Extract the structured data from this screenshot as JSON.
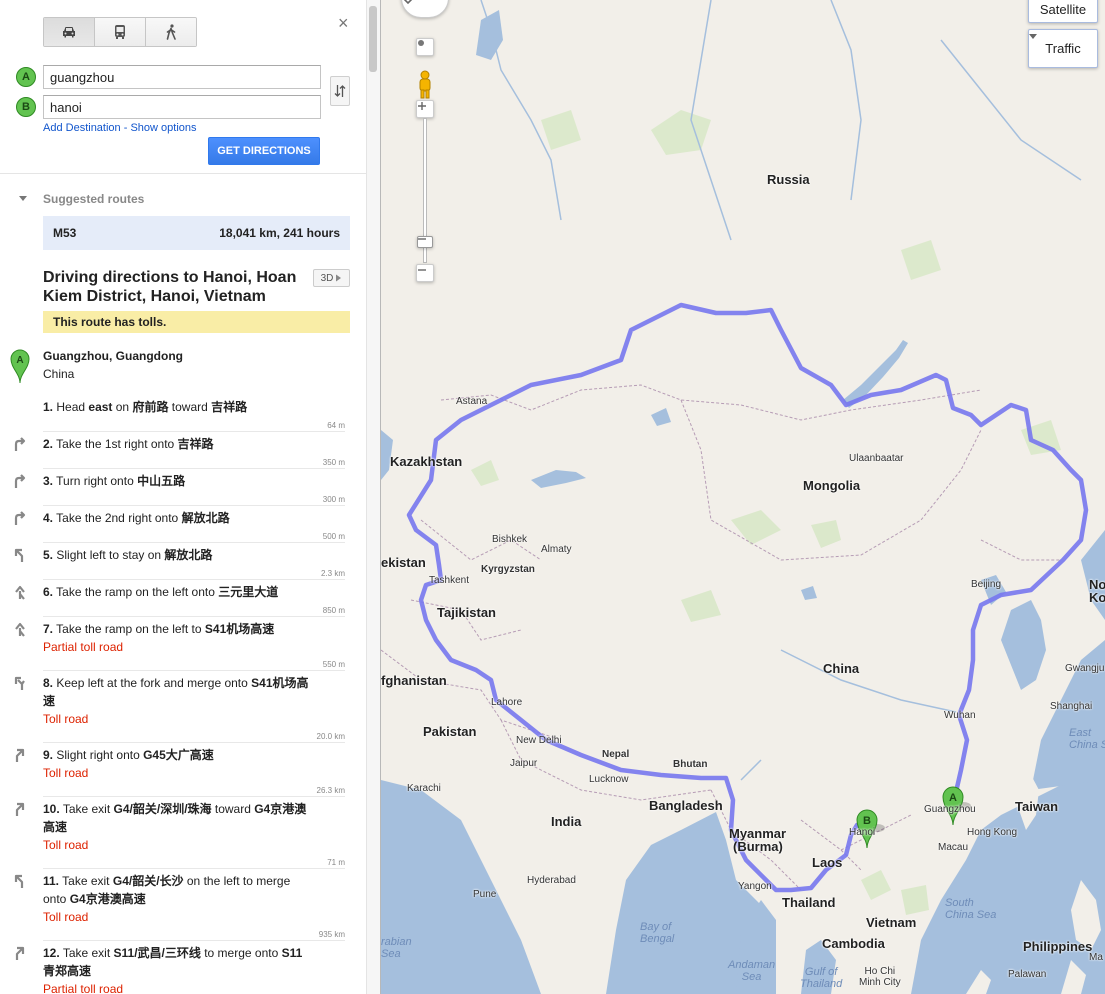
{
  "travel_modes": [
    {
      "name": "car-icon",
      "active": true
    },
    {
      "name": "bus-icon",
      "active": false
    },
    {
      "name": "walk-icon",
      "active": false
    }
  ],
  "close_label": "×",
  "origin": {
    "marker": "A",
    "value": "guangzhou"
  },
  "destination": {
    "marker": "B",
    "value": "hanoi"
  },
  "add_destination": "Add Destination",
  "options_sep": " - ",
  "show_options": "Show options",
  "get_directions": "GET DIRECTIONS",
  "suggested_routes_title": "Suggested routes",
  "route": {
    "name": "M53",
    "summary": "18,041 km, 241 hours"
  },
  "directions_title": "Driving directions to Hanoi, Hoan Kiem District, Hanoi, Vietnam",
  "btn_3d": "3D",
  "toll_notice": "This route has tolls.",
  "start": {
    "marker": "A",
    "name": "Guangzhou, Guangdong",
    "country": "China"
  },
  "steps": [
    {
      "num": "1.",
      "pre": "Head ",
      "b1": "east",
      "mid": " on ",
      "b2": "府前路",
      "post": " toward ",
      "b3": "吉祥路",
      "toll": "",
      "dist": "64 m",
      "icon": "straight-icon"
    },
    {
      "num": "2.",
      "pre": "Take the 1st right onto ",
      "b1": "吉祥路",
      "mid": "",
      "b2": "",
      "post": "",
      "b3": "",
      "toll": "",
      "dist": "350 m",
      "icon": "turn-right-icon"
    },
    {
      "num": "3.",
      "pre": "Turn right onto ",
      "b1": "中山五路",
      "mid": "",
      "b2": "",
      "post": "",
      "b3": "",
      "toll": "",
      "dist": "300 m",
      "icon": "turn-right-icon"
    },
    {
      "num": "4.",
      "pre": "Take the 2nd right onto ",
      "b1": "解放北路",
      "mid": "",
      "b2": "",
      "post": "",
      "b3": "",
      "toll": "",
      "dist": "500 m",
      "icon": "turn-right-icon"
    },
    {
      "num": "5.",
      "pre": "Slight left to stay on ",
      "b1": "解放北路",
      "mid": "",
      "b2": "",
      "post": "",
      "b3": "",
      "toll": "",
      "dist": "2.3 km",
      "icon": "slight-left-icon"
    },
    {
      "num": "6.",
      "pre": "Take the ramp on the left onto ",
      "b1": "三元里大道",
      "mid": "",
      "b2": "",
      "post": "",
      "b3": "",
      "toll": "",
      "dist": "850 m",
      "icon": "ramp-left-icon"
    },
    {
      "num": "7.",
      "pre": "Take the ramp on the left to ",
      "b1": "S41机场高速",
      "mid": "",
      "b2": "",
      "post": "",
      "b3": "",
      "toll": "Partial toll road",
      "dist": "550 m",
      "icon": "ramp-left-icon"
    },
    {
      "num": "8.",
      "pre": "Keep left at the fork and merge onto ",
      "b1": "S41机场高速",
      "mid": "",
      "b2": "",
      "post": "",
      "b3": "",
      "toll": "Toll road",
      "dist": "20.0 km",
      "icon": "fork-left-icon"
    },
    {
      "num": "9.",
      "pre": "Slight right onto ",
      "b1": "G45大广高速",
      "mid": "",
      "b2": "",
      "post": "",
      "b3": "",
      "toll": "Toll road",
      "dist": "26.3 km",
      "icon": "slight-right-icon"
    },
    {
      "num": "10.",
      "pre": "Take exit ",
      "b1": "G4/韶关/深圳/珠海",
      "mid": " toward ",
      "b2": "G4京港澳高速",
      "post": "",
      "b3": "",
      "toll": "Toll road",
      "dist": "71 m",
      "icon": "exit-right-icon"
    },
    {
      "num": "11.",
      "pre": "Take exit ",
      "b1": "G4/韶关/长沙",
      "mid": " on the left to merge onto ",
      "b2": "G4京港澳高速",
      "post": "",
      "b3": "",
      "toll": "Toll road",
      "dist": "935 km",
      "icon": "exit-left-icon"
    },
    {
      "num": "12.",
      "pre": "Take exit ",
      "b1": "S11/武昌/三环线",
      "mid": " to merge onto ",
      "b2": "S11青郑高速",
      "post": "",
      "b3": "",
      "toll": "Partial toll road",
      "dist": "",
      "icon": "exit-right-icon"
    }
  ],
  "map": {
    "satellite": "Satellite",
    "traffic": "Traffic",
    "route_color": "#7777ee",
    "land_color": "#f2efe9",
    "water_color": "#a5bfdd",
    "labels": {
      "russia": "Russia",
      "kazakhstan": "Kazakhstan",
      "mongolia": "Mongolia",
      "china": "China",
      "uzbekistan": "ekistan",
      "kyrgyzstan": "Kyrgyzstan",
      "tajikistan": "Tajikistan",
      "afghanistan": "fghanistan",
      "pakistan": "Pakistan",
      "india": "India",
      "nepal": "Nepal",
      "bhutan": "Bhutan",
      "bangladesh": "Bangladesh",
      "myanmar": "Myanmar",
      "burma": "(Burma)",
      "laos": "Laos",
      "thailand": "Thailand",
      "vietnam": "Vietnam",
      "cambodia": "Cambodia",
      "taiwan": "Taiwan",
      "philippines": "Philippines",
      "north_korea": "No",
      "korea2": "Ko",
      "astana": "Astana",
      "ulaanbaatar": "Ulaanbaatar",
      "bishkek": "Bishkek",
      "almaty": "Almaty",
      "tashkent": "Tashkent",
      "beijing": "Beijing",
      "gwangju": "Gwangju",
      "shanghai": "Shanghai",
      "wuhan": "Wuhan",
      "guangzhou": "Guangzhou",
      "hong_kong": "Hong Kong",
      "macau": "Macau",
      "hanoi": "Hanoi",
      "lahore": "Lahore",
      "new_delhi": "New Delhi",
      "jaipur": "Jaipur",
      "lucknow": "Lucknow",
      "karachi": "Karachi",
      "hyderabad": "Hyderabad",
      "pune": "Pune",
      "yangon": "Yangon",
      "ho_chi_minh": "Ho Chi\nMinh City",
      "palawan": "Palawan",
      "manila": "Ma",
      "east_china_sea": "East\nChina Sea",
      "south_china_sea": "South\nChina Sea",
      "bay_of_bengal": "Bay of\nBengal",
      "arabian_sea": "rabian\nSea",
      "andaman_sea": "Andaman\nSea",
      "gulf_of_thailand": "Gulf of\nThailand"
    }
  }
}
